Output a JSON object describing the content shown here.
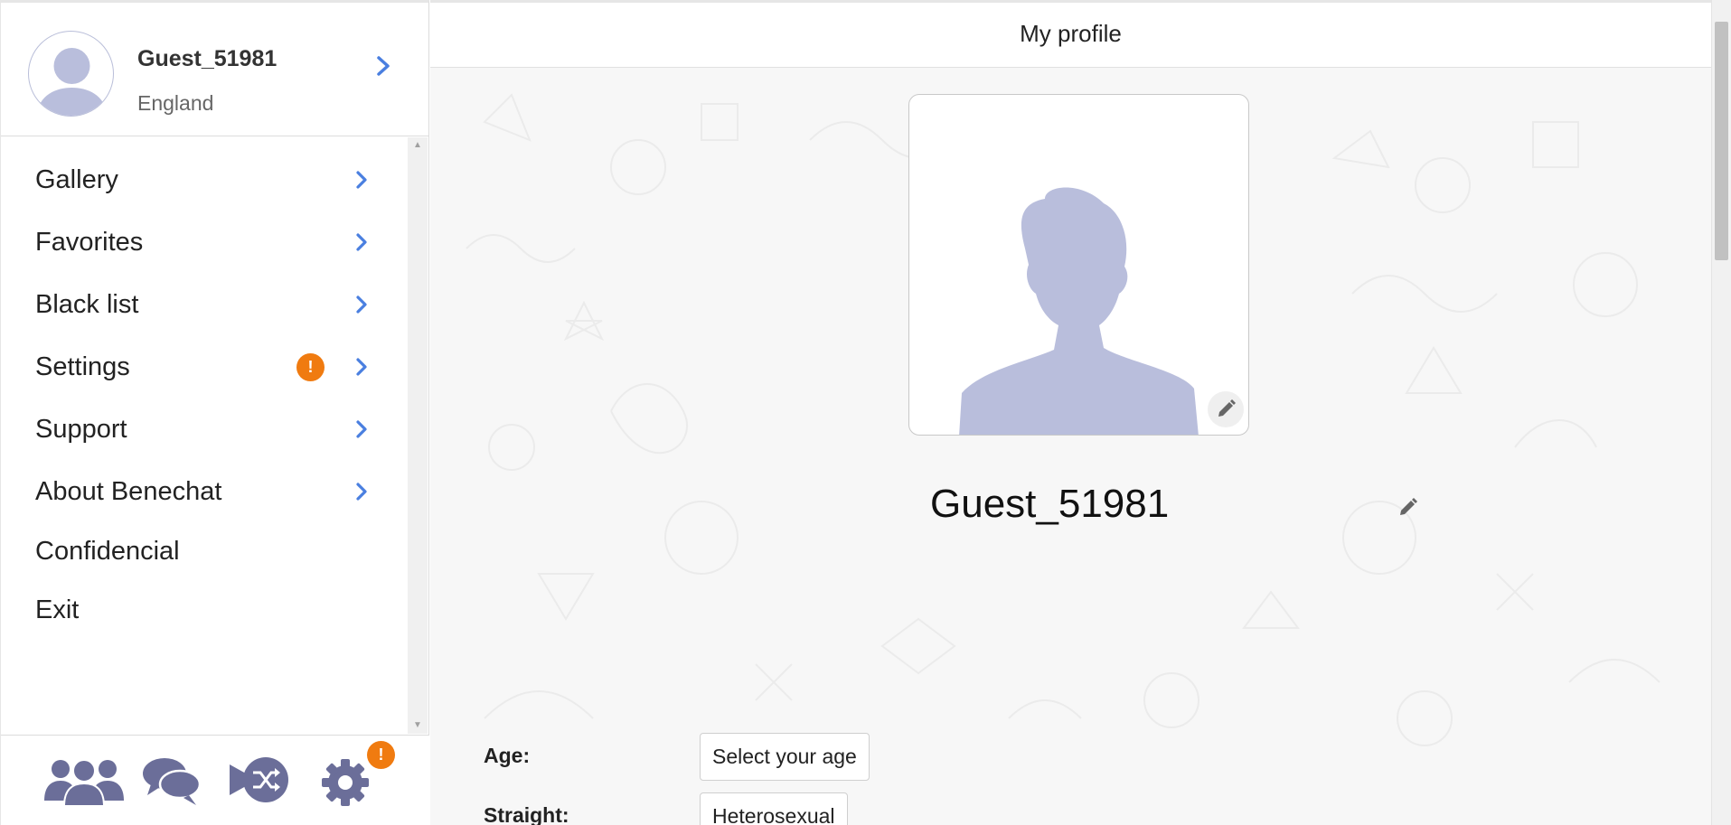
{
  "sidebar": {
    "user": {
      "name": "Guest_51981",
      "country": "England"
    },
    "menu": [
      {
        "label": "Gallery",
        "chevron": true
      },
      {
        "label": "Favorites",
        "chevron": true
      },
      {
        "label": "Black list",
        "chevron": true
      },
      {
        "label": "Settings",
        "chevron": true,
        "badge": "!"
      },
      {
        "label": "Support",
        "chevron": true
      },
      {
        "label": "About Benechat",
        "chevron": true
      },
      {
        "label": "Confidencial",
        "chevron": false
      },
      {
        "label": "Exit",
        "chevron": false
      }
    ],
    "bottom_nav": {
      "icons": [
        "people-icon",
        "chat-bubbles-icon",
        "shuffle-icon",
        "gear-icon"
      ],
      "settings_badge": "!"
    }
  },
  "main": {
    "title": "My profile",
    "profile_name": "Guest_51981",
    "fields": [
      {
        "label": "Age:",
        "value": "Select your age"
      },
      {
        "label": "Straight:",
        "value": "Heterosexual"
      }
    ]
  },
  "colors": {
    "accent_blue": "#4a7fe0",
    "avatar_fill": "#b9bedc",
    "badge_orange": "#f07b10",
    "nav_icon": "#6b6e99"
  }
}
